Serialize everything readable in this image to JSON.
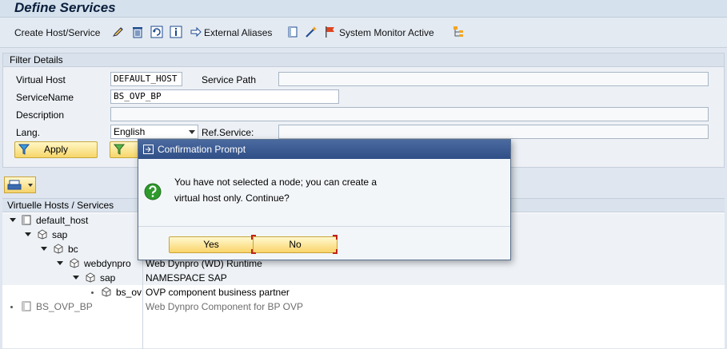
{
  "window": {
    "title": "Define Services"
  },
  "toolbar": {
    "create_host_label": "Create Host/Service",
    "external_aliases_label": "External Aliases",
    "system_monitor_label": "System Monitor Active",
    "icons": [
      "edit-icon",
      "delete-icon",
      "refresh-icon",
      "info-icon",
      "arrow-icon",
      "book-icon",
      "wand-icon",
      "flag-icon",
      "hierarchy-icon"
    ]
  },
  "filter": {
    "section_title": "Filter Details",
    "virtual_host_label": "Virtual Host",
    "virtual_host_value": "DEFAULT_HOST",
    "service_path_label": "Service Path",
    "service_path_value": "",
    "service_name_label": "ServiceName",
    "service_name_value": "BS_OVP_BP",
    "description_label": "Description",
    "description_value": "",
    "lang_label": "Lang.",
    "lang_value": "English",
    "ref_service_label": "Ref.Service:",
    "ref_service_value": "",
    "apply_label": "Apply"
  },
  "tree": {
    "header": "Virtuelle Hosts / Services",
    "rows": [
      {
        "name": "default_host",
        "desc": ""
      },
      {
        "name": "sap",
        "desc": ""
      },
      {
        "name": "bc",
        "desc": ""
      },
      {
        "name": "webdynpro",
        "desc": "Web Dynpro (WD) Runtime"
      },
      {
        "name": "sap",
        "desc": "NAMESPACE SAP"
      },
      {
        "name": "bs_ov",
        "desc": "OVP component business partner"
      },
      {
        "name": "BS_OVP_BP",
        "desc": "Web Dynpro Component for BP OVP"
      }
    ]
  },
  "dialog": {
    "title": "Confirmation Prompt",
    "message_line1": "You have not selected a node; you can create a",
    "message_line2": "virtual host only. Continue?",
    "yes_label": "Yes",
    "no_label": "No"
  },
  "colors": {
    "accent": "#2f4e86",
    "button_yellow": "#f9d46a",
    "focus_red": "#c0221b",
    "question_green": "#2e9a2c"
  }
}
